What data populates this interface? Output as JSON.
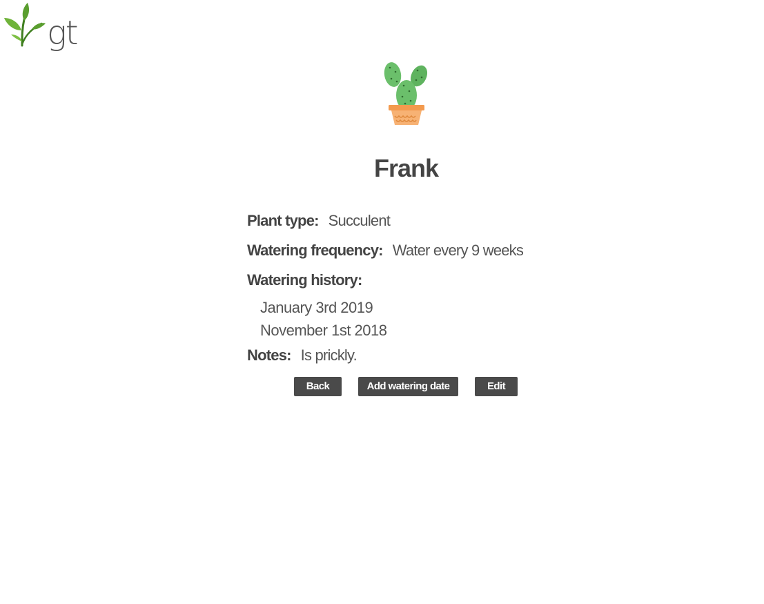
{
  "logo": {
    "text": "gt",
    "icon": "sprout-icon"
  },
  "plant": {
    "icon": "potted-cactus-icon",
    "name": "Frank",
    "type_label": "Plant type:",
    "type_value": "Succulent",
    "frequency_label": "Watering frequency:",
    "frequency_value": "Water every 9 weeks",
    "history_label": "Watering history:",
    "history": [
      "January 3rd 2019",
      "November 1st 2018"
    ],
    "notes_label": "Notes:",
    "notes_value": "Is prickly."
  },
  "actions": {
    "back_label": "Back",
    "add_label": "Add watering date",
    "edit_label": "Edit"
  },
  "colors": {
    "button_bg": "#4a4a4a",
    "leaf_green": "#5a9e2f",
    "cactus_green": "#6bbf6b",
    "pot_orange": "#f5a25d"
  }
}
